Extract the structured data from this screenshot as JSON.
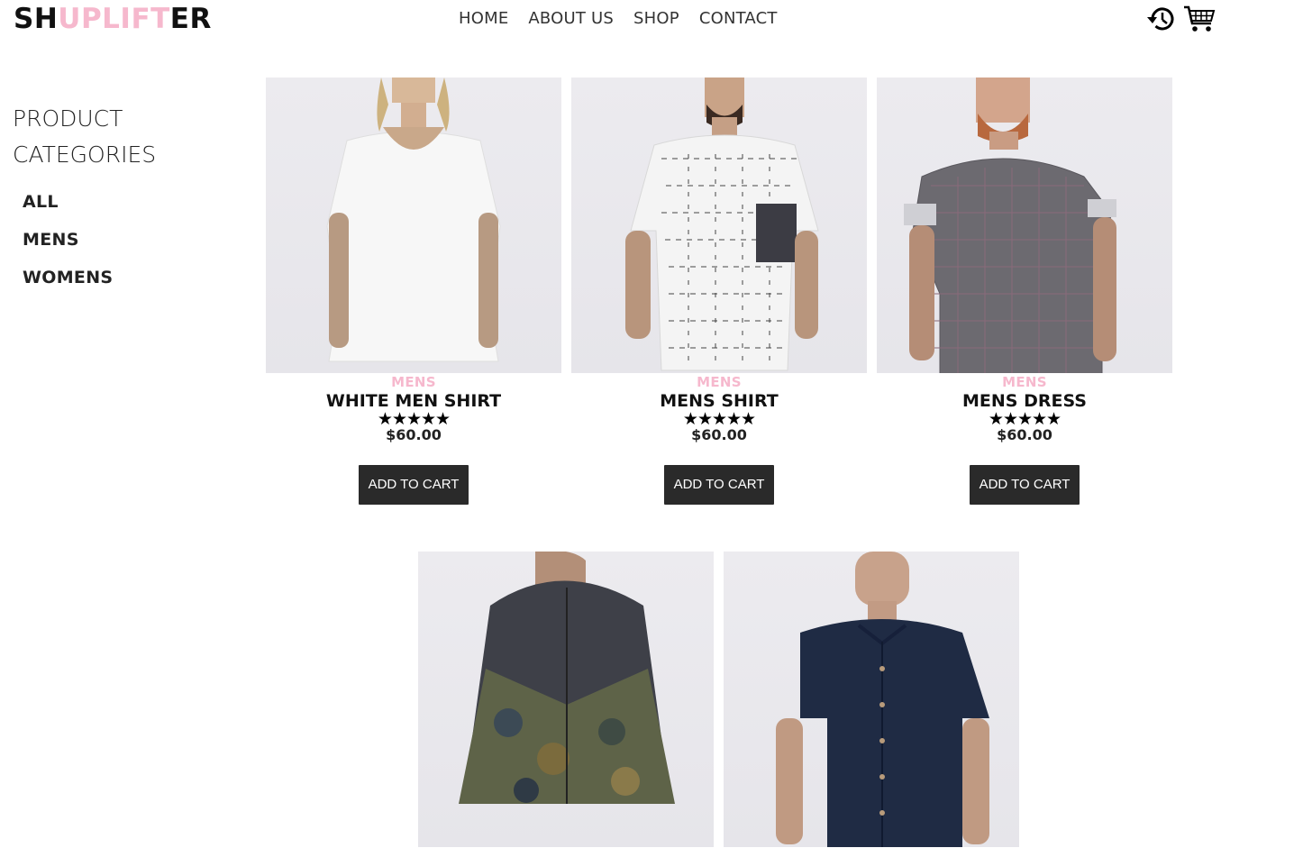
{
  "header": {
    "logo_prefix": "SH",
    "logo_accent": "UPLIFT",
    "logo_suffix": "ER",
    "nav": [
      "HOME",
      "ABOUT US",
      "SHOP",
      "CONTACT"
    ]
  },
  "sidebar": {
    "title": "PRODUCT CATEGORIES",
    "categories": [
      "ALL",
      "MENS",
      "WOMENS"
    ]
  },
  "products": [
    {
      "category": "MENS",
      "name": "WHITE MEN SHIRT",
      "stars": "★★★★★",
      "rating": 5,
      "price": "$60.00",
      "button": "ADD TO CART"
    },
    {
      "category": "MENS",
      "name": "MENS SHIRT",
      "stars": "★★★★★",
      "rating": 5,
      "price": "$60.00",
      "button": "ADD TO CART"
    },
    {
      "category": "MENS",
      "name": "MENS DRESS",
      "stars": "★★★★★",
      "rating": 5,
      "price": "$60.00",
      "button": "ADD TO CART"
    },
    {
      "category": "",
      "name": "",
      "stars": "",
      "price": "",
      "button": ""
    },
    {
      "category": "",
      "name": "",
      "stars": "",
      "price": "",
      "button": ""
    }
  ],
  "colors": {
    "accent": "#f6b8cd",
    "button_bg": "#2a2a2a",
    "photo_bg": "#e8e7ec"
  },
  "icons": {
    "history": "history-icon",
    "cart": "cart-icon"
  }
}
